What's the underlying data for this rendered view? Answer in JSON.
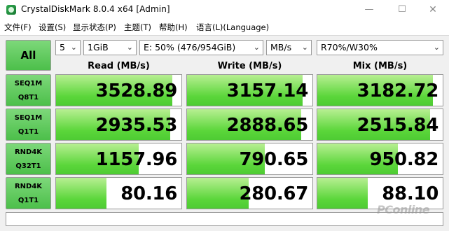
{
  "window": {
    "title": "CrystalDiskMark 8.0.4 x64 [Admin]",
    "minimize": "—",
    "maximize": "☐",
    "close": "✕"
  },
  "menu": [
    "文件(F)",
    "设置(S)",
    "显示状态(P)",
    "主题(T)",
    "帮助(H)",
    "语言(L)(Language)"
  ],
  "toolbar": {
    "all_label": "All",
    "count": "5",
    "size": "1GiB",
    "drive": "E: 50% (476/954GiB)",
    "unit": "MB/s",
    "mix": "R70%/W30%"
  },
  "columns": [
    "Read (MB/s)",
    "Write (MB/s)",
    "Mix (MB/s)"
  ],
  "rows": [
    {
      "line1": "SEQ1M",
      "line2": "Q8T1",
      "read": "3528.89",
      "write": "3157.14",
      "mix": "3182.72",
      "read_fill": 0.93,
      "write_fill": 0.92,
      "mix_fill": 0.92
    },
    {
      "line1": "SEQ1M",
      "line2": "Q1T1",
      "read": "2935.53",
      "write": "2888.65",
      "mix": "2515.84",
      "read_fill": 0.91,
      "write_fill": 0.91,
      "mix_fill": 0.9
    },
    {
      "line1": "RND4K",
      "line2": "Q32T1",
      "read": "1157.96",
      "write": "790.65",
      "mix": "950.82",
      "read_fill": 0.66,
      "write_fill": 0.62,
      "mix_fill": 0.64
    },
    {
      "line1": "RND4K",
      "line2": "Q1T1",
      "read": "80.16",
      "write": "280.67",
      "mix": "88.10",
      "read_fill": 0.4,
      "write_fill": 0.49,
      "mix_fill": 0.4
    }
  ],
  "comment": "",
  "watermark": "PConline",
  "colors": {
    "accent_green": "#4cbf4a",
    "bar_green": "#5bd63a"
  }
}
